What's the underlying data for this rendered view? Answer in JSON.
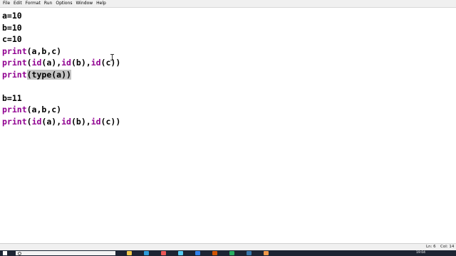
{
  "menu": [
    "File",
    "Edit",
    "Format",
    "Run",
    "Options",
    "Window",
    "Help"
  ],
  "code_lines": [
    [
      {
        "t": "a=10"
      }
    ],
    [
      {
        "t": "b=10"
      }
    ],
    [
      {
        "t": "c=10"
      }
    ],
    [
      {
        "t": "print",
        "cls": "kw"
      },
      {
        "t": "(a,b,c)"
      }
    ],
    [
      {
        "t": "print",
        "cls": "kw"
      },
      {
        "t": "("
      },
      {
        "t": "id",
        "cls": "kw"
      },
      {
        "t": "(a),"
      },
      {
        "t": "id",
        "cls": "kw"
      },
      {
        "t": "(b),"
      },
      {
        "t": "id",
        "cls": "kw"
      },
      {
        "t": "(c))"
      }
    ],
    [
      {
        "t": "print",
        "cls": "kw"
      },
      {
        "t": "(type(a))",
        "cls": "sel"
      }
    ],
    [],
    [
      {
        "t": "b=11"
      }
    ],
    [
      {
        "t": "print",
        "cls": "kw"
      },
      {
        "t": "(a,b,c)"
      }
    ],
    [
      {
        "t": "print",
        "cls": "kw"
      },
      {
        "t": "("
      },
      {
        "t": "id",
        "cls": "kw"
      },
      {
        "t": "(a),"
      },
      {
        "t": "id",
        "cls": "kw"
      },
      {
        "t": "(b),"
      },
      {
        "t": "id",
        "cls": "kw"
      },
      {
        "t": "(c))"
      }
    ]
  ],
  "status": {
    "line": "Ln: 6",
    "col": "Col: 14"
  },
  "taskbar": {
    "clock": "19:04",
    "icons": [
      {
        "name": "file-explorer-icon",
        "color": "#f2c94c"
      },
      {
        "name": "edge-icon",
        "color": "#2d9cdb"
      },
      {
        "name": "chrome-icon",
        "color": "#eb5757"
      },
      {
        "name": "store-icon",
        "color": "#56ccf2"
      },
      {
        "name": "word-icon",
        "color": "#2f80ed"
      },
      {
        "name": "powerpoint-icon",
        "color": "#d35400"
      },
      {
        "name": "excel-icon",
        "color": "#27ae60"
      },
      {
        "name": "python-icon",
        "color": "#3776ab"
      },
      {
        "name": "idle-icon",
        "color": "#f2994a"
      }
    ]
  }
}
